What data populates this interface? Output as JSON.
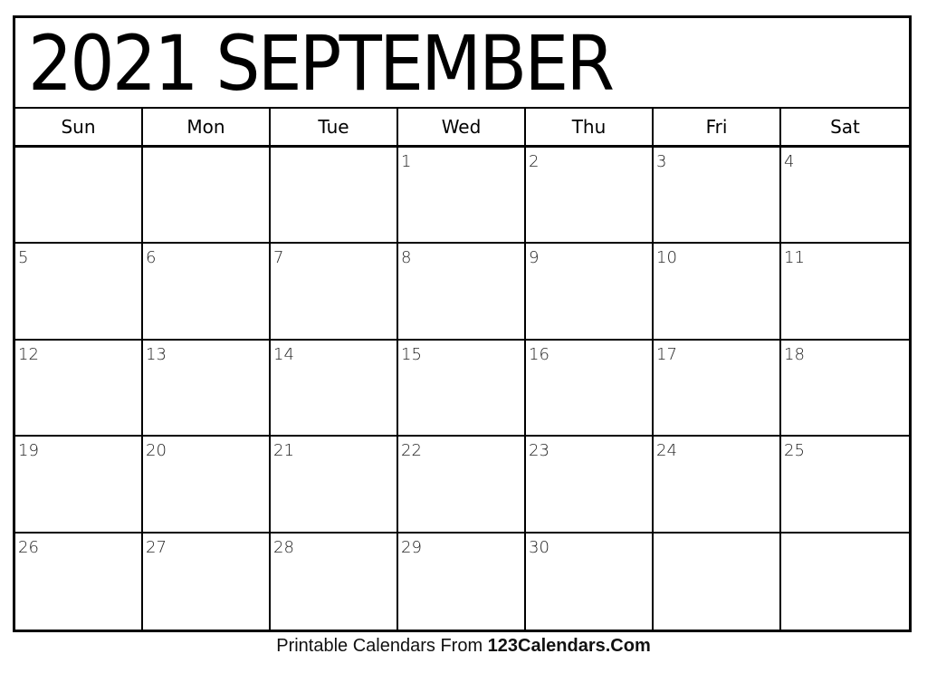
{
  "calendar": {
    "title": "2021 SEPTEMBER",
    "year": 2021,
    "month": "SEPTEMBER",
    "weekdays": [
      "Sun",
      "Mon",
      "Tue",
      "Wed",
      "Thu",
      "Fri",
      "Sat"
    ],
    "weeks": [
      [
        "",
        "",
        "",
        "1",
        "2",
        "3",
        "4"
      ],
      [
        "5",
        "6",
        "7",
        "8",
        "9",
        "10",
        "11"
      ],
      [
        "12",
        "13",
        "14",
        "15",
        "16",
        "17",
        "18"
      ],
      [
        "19",
        "20",
        "21",
        "22",
        "23",
        "24",
        "25"
      ],
      [
        "26",
        "27",
        "28",
        "29",
        "30",
        "",
        ""
      ]
    ]
  },
  "footer": {
    "prefix": "Printable Calendars From ",
    "brand": "123Calendars.Com"
  }
}
